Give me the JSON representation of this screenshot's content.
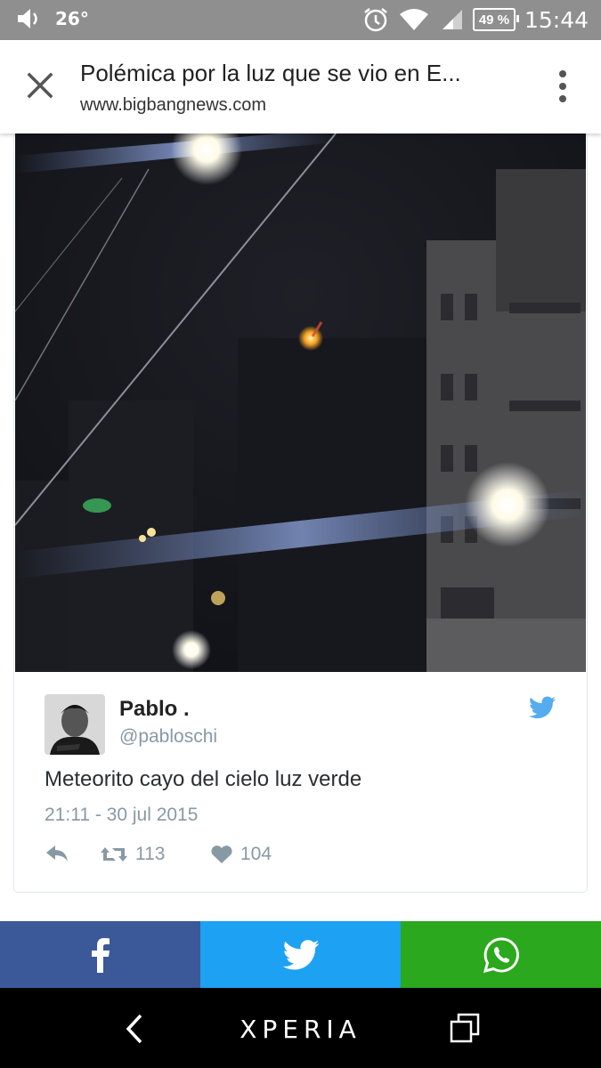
{
  "status_bar": {
    "temperature": "26°",
    "battery": "49 %",
    "time": "15:44",
    "icons": [
      "volume-icon",
      "alarm-icon",
      "wifi-icon",
      "signal-icon",
      "battery-icon"
    ]
  },
  "browser": {
    "title": "Polémica por la luz que se vio en E...",
    "url": "www.bigbangnews.com",
    "close_icon": "close-icon",
    "menu_icon": "more-vert-icon"
  },
  "tweet": {
    "author_name": "Pablo . ",
    "handle": "@pabloschi",
    "text": "Meteorito cayo del cielo luz verde",
    "timestamp": "21:11 - 30 jul 2015",
    "retweets": "113",
    "likes": "104",
    "colors": {
      "twitter_blue": "#55acee",
      "meta_gray": "#8899a6"
    }
  },
  "share_bar": {
    "buttons": [
      {
        "name": "facebook",
        "icon": "facebook-icon",
        "color": "#3b5998"
      },
      {
        "name": "twitter",
        "icon": "twitter-icon",
        "color": "#1da1f2"
      },
      {
        "name": "whatsapp",
        "icon": "whatsapp-icon",
        "color": "#2ba81d"
      }
    ]
  },
  "nav_bar": {
    "brand": "XPERIA"
  }
}
